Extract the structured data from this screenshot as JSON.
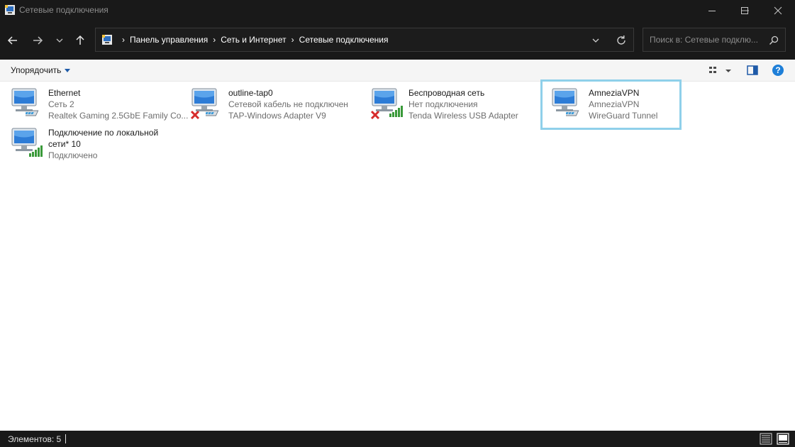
{
  "window": {
    "title": "Сетевые подключения"
  },
  "nav": {
    "breadcrumbs": [
      "Панель управления",
      "Сеть и Интернет",
      "Сетевые подключения"
    ],
    "search_placeholder": "Поиск в: Сетевые подклю..."
  },
  "command_bar": {
    "organize_label": "Упорядочить"
  },
  "connections": [
    {
      "name": "Ethernet",
      "status": "Сеть 2",
      "adapter": "Realtek Gaming 2.5GbE Family Co...",
      "state_icon": "cable"
    },
    {
      "name": "outline-tap0",
      "status": "Сетевой кабель не подключен",
      "adapter": "TAP-Windows Adapter V9",
      "state_icon": "cable-disconnected"
    },
    {
      "name": "Беспроводная сеть",
      "status": "Нет подключения",
      "adapter": "Tenda Wireless USB Adapter",
      "state_icon": "wifi-disconnected"
    },
    {
      "name": "AmneziaVPN",
      "status": "AmneziaVPN",
      "adapter": "WireGuard Tunnel",
      "state_icon": "cable"
    },
    {
      "name": "Подключение по локальной",
      "name_line2": "сети* 10",
      "status": "Подключено",
      "state_icon": "wifi"
    }
  ],
  "status_bar": {
    "count_label": "Элементов: 5"
  },
  "colors": {
    "dark_chrome": "#191919",
    "selection_border": "#8fd0ea",
    "accent_blue": "#1e5aa8"
  }
}
